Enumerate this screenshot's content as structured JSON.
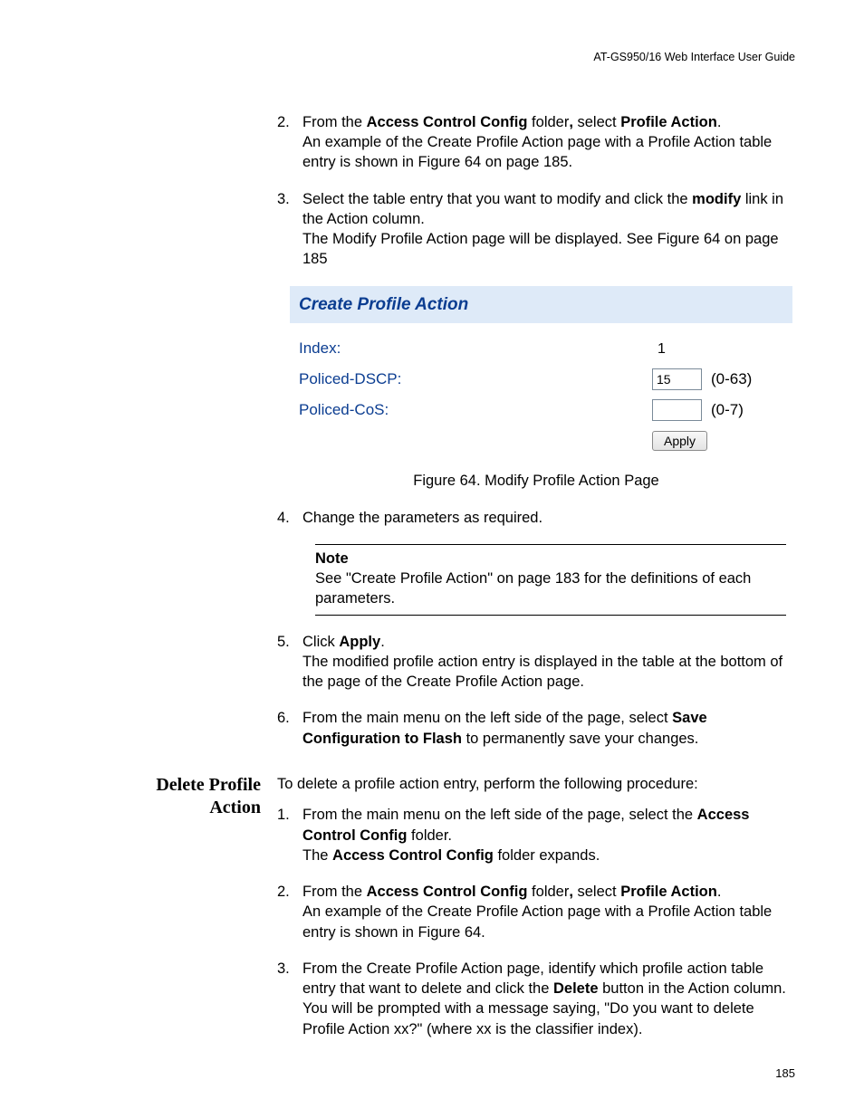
{
  "header": {
    "running_head": "AT-GS950/16  Web Interface User Guide"
  },
  "section1": {
    "steps": {
      "s2": {
        "num": "2.",
        "line1a": "From the ",
        "line1b": "Access Control Config",
        "line1c": " folder",
        "line1d": ", ",
        "line1e": "select ",
        "line1f": "Profile Action",
        "line1g": ".",
        "line2": "An example of the Create Profile Action page with a Profile Action table entry is shown in Figure 64 on page 185."
      },
      "s3": {
        "num": "3.",
        "line1a": "Select the table entry that you want to modify and click the ",
        "line1b": "modify",
        "line1c": " link in the Action column.",
        "line2": "The Modify Profile Action page will be displayed. See Figure 64 on page 185"
      },
      "s4": {
        "num": "4.",
        "text": "Change the parameters as required."
      },
      "s5": {
        "num": "5.",
        "line1a": "Click ",
        "line1b": "Apply",
        "line1c": ".",
        "line2": "The modified profile action entry is displayed in the table at the bottom of the page of the Create Profile Action page."
      },
      "s6": {
        "num": "6.",
        "line1a": "From the main menu on the left side of the page, select ",
        "line1b": "Save Configuration to Flash",
        "line1c": " to permanently save your changes."
      }
    }
  },
  "ui_panel": {
    "title": "Create Profile Action",
    "rows": {
      "index": {
        "label": "Index:",
        "value": "1"
      },
      "dscp": {
        "label": "Policed-DSCP:",
        "value": "15",
        "range": "(0-63)"
      },
      "cos": {
        "label": "Policed-CoS:",
        "value": "",
        "range": "(0-7)"
      }
    },
    "apply_label": "Apply"
  },
  "figure_caption": "Figure 64. Modify Profile Action Page",
  "note": {
    "title": "Note",
    "body": "See \"Create Profile Action\" on page 183 for the definitions of each parameters."
  },
  "section2": {
    "heading_line1": "Delete Profile",
    "heading_line2": "Action",
    "intro": "To delete a profile action entry, perform the following procedure:",
    "steps": {
      "s1": {
        "num": "1.",
        "line1a": "From the main menu on the left side of the page, select the ",
        "line1b": "Access Control Config",
        "line1c": " folder.",
        "line2a": "The ",
        "line2b": "Access Control Config",
        "line2c": " folder expands."
      },
      "s2": {
        "num": "2.",
        "line1a": "From the ",
        "line1b": "Access Control Config",
        "line1c": " folder",
        "line1d": ", ",
        "line1e": "select ",
        "line1f": "Profile Action",
        "line1g": ".",
        "line2": "An example of the Create Profile Action page with a Profile Action table entry is shown in Figure 64."
      },
      "s3": {
        "num": "3.",
        "line1a": "From the Create Profile Action page, identify which profile action table entry that want to delete and click the ",
        "line1b": "Delete",
        "line1c": " button in the Action column.",
        "line2": "You will be prompted with a message saying, \"Do you want to delete Profile Action xx?\" (where xx is the classifier index)."
      }
    }
  },
  "page_number": "185"
}
